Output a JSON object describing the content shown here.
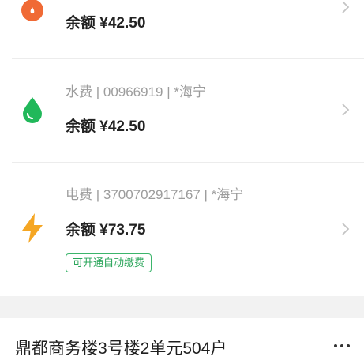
{
  "colors": {
    "gas_icon": "#f06a35",
    "water_icon": "#21b85a",
    "electric_icon": "#f5a623",
    "badge": "#2aa55a",
    "chevron": "#c4c4c4",
    "section_gap": "#f2f2f2"
  },
  "bills": [
    {
      "icon": "flame-icon",
      "subtitle": "",
      "balance_label": "余额 ¥42.50"
    },
    {
      "icon": "water-drop-icon",
      "subtitle": "水费 | 00966919 | *海宁",
      "balance_label": "余额 ¥42.50"
    },
    {
      "icon": "lightning-icon",
      "subtitle": "电费 | 3700702917167 | *海宁",
      "balance_label": "余额 ¥73.75",
      "badge": "可开通自动缴费"
    }
  ],
  "address": {
    "title": "鼎都商务楼3号楼2单元504户",
    "more_icon": "more-icon"
  }
}
